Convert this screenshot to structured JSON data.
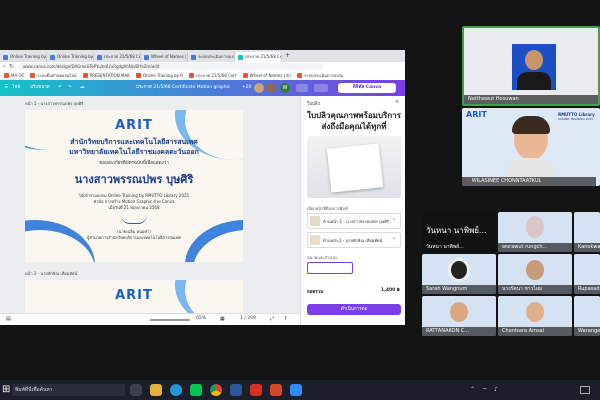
{
  "browser": {
    "tabs": [
      {
        "label": "Online Training by RMUTTO"
      },
      {
        "label": "Online Training by RMUTTO"
      },
      {
        "label": "ประกาศ 21/5/68 Certifi"
      },
      {
        "label": "Wheel of Names | ตัวเลือ"
      },
      {
        "label": "ระบบประเมินการอบรม ระบบ"
      },
      {
        "label": "ประกาศ 21/5/68 Certif"
      }
    ],
    "url": "www.canva.com/design/DAGmeUTePYu/bdLfuRgdgAhNjvBlYsZm/edit",
    "bookmarks": [
      "MA OC",
      "ระบบยื่นคำขอออนไลน์",
      "PRESENTATION MAK",
      "Online Training by R",
      "ประกาศ 21/5/68 Cert",
      "Wheel of Names | ตัว",
      "ระบบประเมินการอบรม"
    ]
  },
  "canva": {
    "toolbar": {
      "file_label": "ไฟล์",
      "resize_label": "ปรับขนาด",
      "doc_title": "ประกาศ 21/5/68 Certificate Motion graphic",
      "counter": "+20",
      "avatar_initial": "W",
      "share_label": "ดิจิทัล Canva"
    },
    "pages": [
      {
        "label": "หน้า 1 - นางสาวพรรณปพร บุษศิริ"
      },
      {
        "label": "หน้า 2 - นายทักษิณ เทียมทัศน์"
      }
    ],
    "certificate": {
      "logo": "ARIT",
      "office_line1": "สำนักวิทยบริการและเทคโนโลยีสารสนเทศ",
      "office_line2": "มหาวิทยาลัยเทคโนโลยีราชมงคลตะวันออก",
      "award_line": "ขอมอบเกียรติบัตรฉบับนี้เพื่อแสดงว่า",
      "recipient": "นางสาวพรรณปพร บุษศิริ",
      "course_line1": "ได้เข้าร่วมอบรม Online Training by RMUTTO Library 2025",
      "course_line2": "หัวข้อ การสร้าง Motion Graphic ด้วย Canva",
      "date_line": "เมื่อวันที่ 21 พฤษภาคม 2568",
      "signer_name": "(นายเฉลิม หน่อคำ)",
      "signer_title": "ผู้อำนวยการสำนักวิทยบริการและเทคโนโลยีสารสนเทศ"
    },
    "status": {
      "zoom": "65%",
      "page_counter": "1 / 209"
    },
    "panel": {
      "title": "ใบปลิว",
      "headline": "ใบปลิวคุณภาพพร้อมบริการส่งถึงมือคุณได้ทุกที่",
      "section_label": "เลือกหน้าที่ต้องการพิมพ์",
      "options": [
        {
          "label": "ด้านหน้า 1 - นางสาวพรรณปพร บุษศิริ"
        },
        {
          "label": "ด้านหลัง 2 - นายทักษิณ เทียมทัศน์"
        }
      ],
      "size_label": "ขนาดและจำนวน",
      "total_label": "ยอดรวม",
      "total_value": "1,400 ฿",
      "cta_label": "ดำเนินการต่อ"
    }
  },
  "meeting": {
    "speaker": {
      "name": "Natthawut Hosuwan"
    },
    "shared_name": "WILASINEE CHONNTAATKUL",
    "brand": "RMUTTO Library",
    "brand_sub": "ONLINE TRAINING 2025",
    "grid_title": "วันหนา นาพิพย์...",
    "participants": [
      {
        "name": "วันหนา นาพิพย์..."
      },
      {
        "name": "worawut rungch..."
      },
      {
        "name": "Kanokwan"
      },
      {
        "name": "Sarah Wangnum"
      },
      {
        "name": "นางรัตนา ชาวไผ่ม"
      },
      {
        "name": "Rupasad"
      },
      {
        "name": "RATTANAKON C..."
      },
      {
        "name": "Chanisara Amsai"
      },
      {
        "name": "Warange"
      }
    ]
  },
  "taskbar": {
    "search_placeholder": "พิมพ์ที่นี่เพื่อค้นหา",
    "icons": [
      "windows-start-icon",
      "task-view-icon",
      "file-explorer-icon",
      "edge-icon",
      "line-icon",
      "chrome-icon",
      "word-icon",
      "acrobat-icon",
      "powerpoint-icon",
      "zoom-icon"
    ],
    "time": "",
    "colors": {
      "accent": "#7b3fe4",
      "teal": "#13c3c9"
    }
  }
}
